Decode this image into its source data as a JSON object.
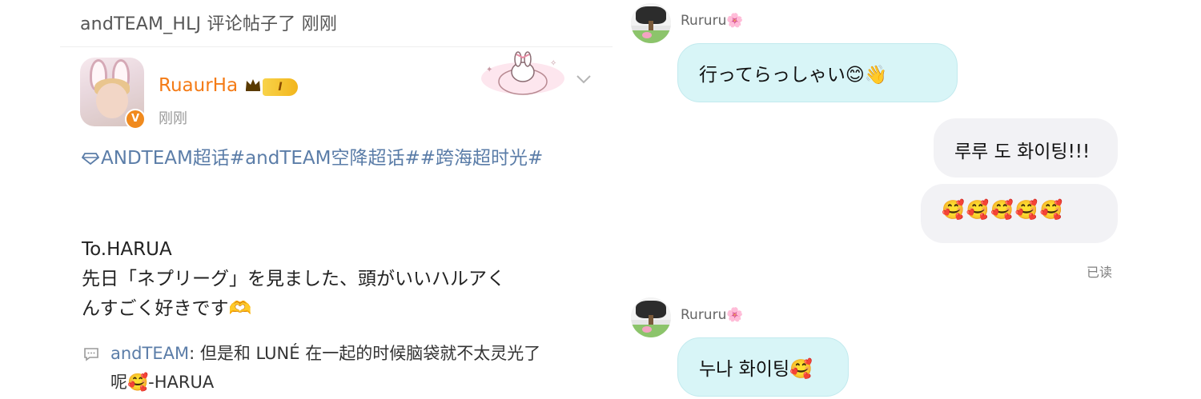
{
  "left_post": {
    "notification": "andTEAM_HLJ 评论帖子了 刚刚",
    "user": {
      "name": "RuaurHa",
      "level_badge": "I",
      "timestamp": "刚刚"
    },
    "topics_text": "ANDTEAM超话#andTEAM空降超话##跨海超时光#",
    "content_lines": [
      "To.HARUA",
      "先日「ネプリーグ」を見ました、頭がいいハルアく",
      "んすごく好きです🫶"
    ],
    "comment": {
      "author": "andTEAM",
      "text_line1": ": 但是和 LUNÉ 在一起的时候脑袋就不太灵光了",
      "text_line2": "呢🥰-HARUA"
    }
  },
  "chat": {
    "contact_name": "Rururu🌸",
    "messages": [
      {
        "from": "them",
        "text": "行ってらっしゃい😊👋"
      },
      {
        "from": "me",
        "text": "루루 도 화이팅!!!"
      },
      {
        "from": "me",
        "text": "🥰🥰🥰🥰🥰"
      },
      {
        "from": "them",
        "text": "누나 화이팅🥰"
      }
    ],
    "read_status": "已读"
  },
  "colors": {
    "username": "#f47b16",
    "link_blue": "#5b7da8",
    "their_bubble": "#d8f5f7",
    "my_bubble": "#f2f2f5"
  },
  "icons": {
    "verify": "verified-v-icon",
    "crown": "crown-icon",
    "chevron": "chevron-down-icon",
    "topic": "diamond-topic-icon",
    "comment": "comment-icon"
  }
}
